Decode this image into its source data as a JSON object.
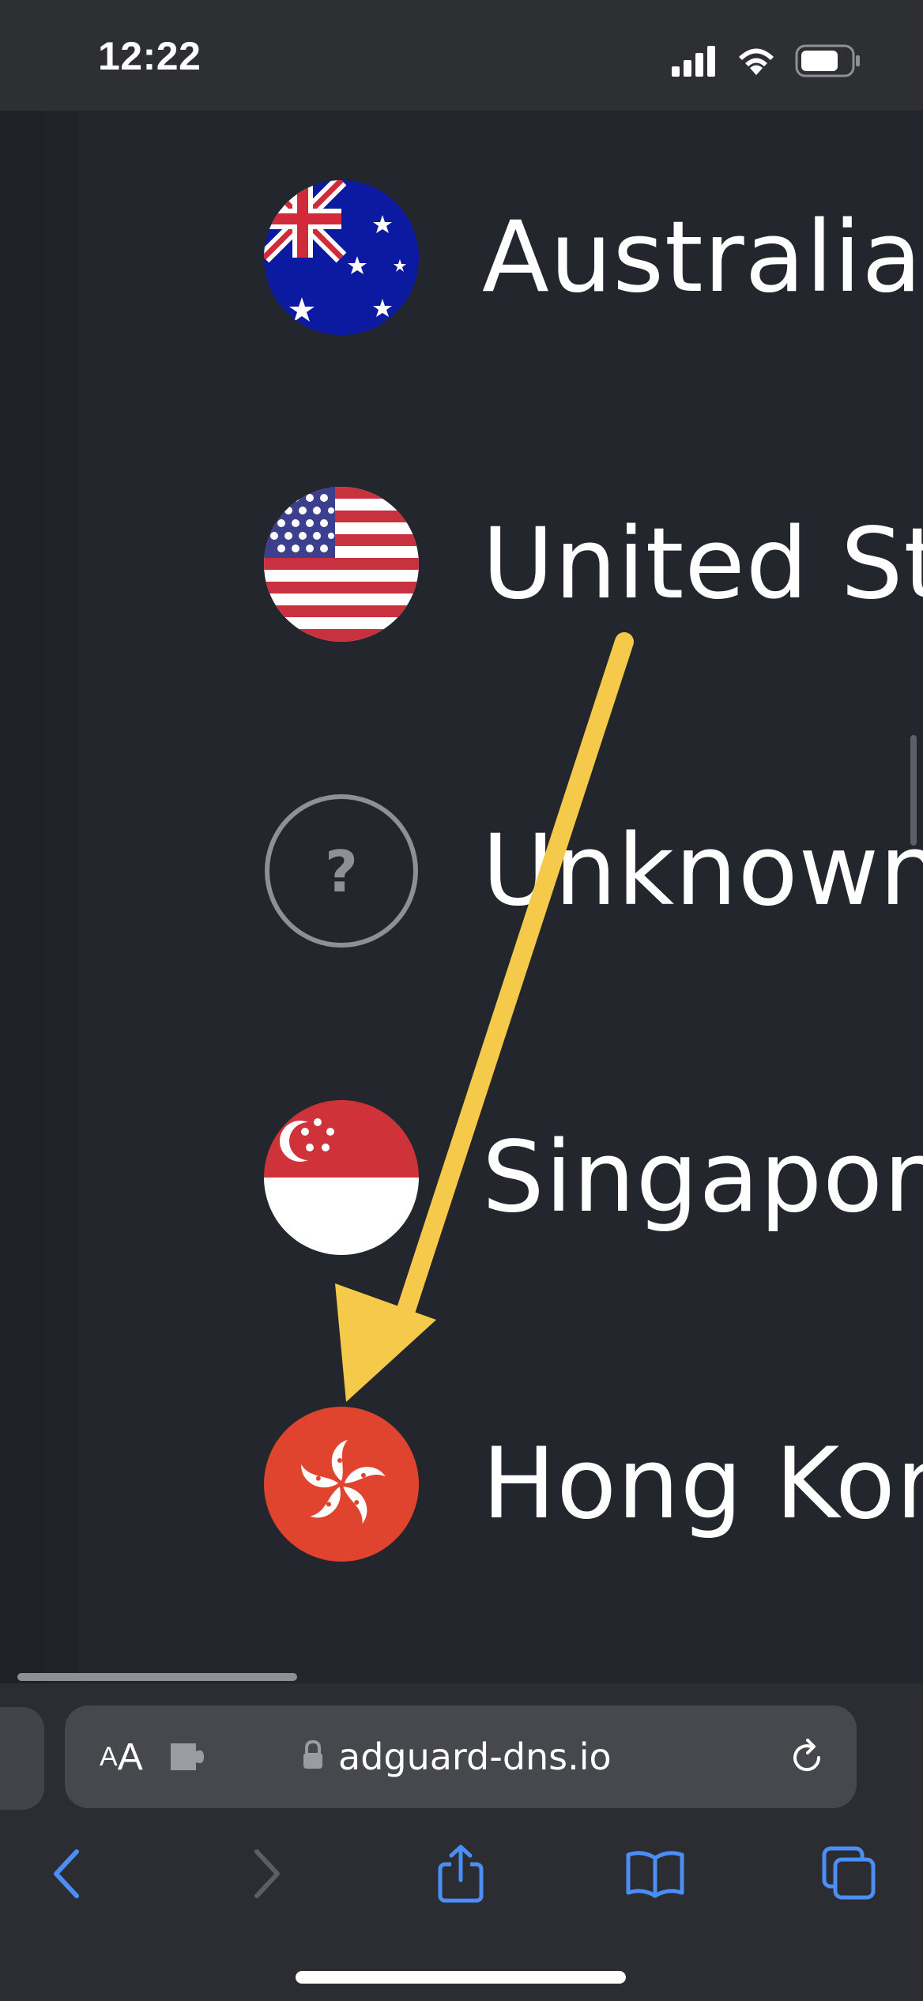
{
  "status_bar": {
    "time": "12:22",
    "icons": [
      "cellular-signal-icon",
      "wifi-icon",
      "battery-icon"
    ]
  },
  "countries": [
    {
      "name": "Australia",
      "flag": "australia-flag-icon"
    },
    {
      "name": "United St",
      "flag": "united-states-flag-icon"
    },
    {
      "name": "Unknown",
      "flag": "question-mark-icon"
    },
    {
      "name": "Singapor",
      "flag": "singapore-flag-icon"
    },
    {
      "name": "Hong Kon",
      "flag": "hong-kong-flag-icon"
    }
  ],
  "annotation": {
    "color": "#f5c94a",
    "icon": "arrow-annotation"
  },
  "browser": {
    "text_size_small": "A",
    "text_size_large": "A",
    "url": "adguard-dns.io",
    "accent": "#4a8ff5",
    "toolbar_icons": [
      "back-icon",
      "forward-icon",
      "share-icon",
      "bookmarks-icon",
      "tabs-icon"
    ]
  }
}
